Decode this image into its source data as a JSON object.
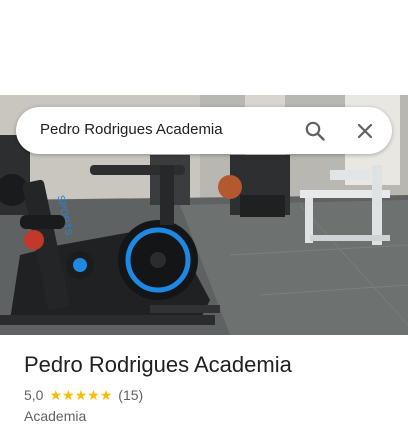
{
  "search": {
    "query": "Pedro Rodrigues Academia"
  },
  "place": {
    "title": "Pedro Rodrigues Academia",
    "rating": "5,0",
    "rating_stars": 5,
    "reviews": "(15)",
    "category": "Academia"
  },
  "hero": {
    "bike_brand_text": "SPORTS"
  },
  "icons": {
    "search": "search-icon",
    "close": "close-icon",
    "star": "star-icon"
  },
  "colors": {
    "star": "#fbbc04",
    "accent_blue": "#1e88e5",
    "text_primary": "#202124",
    "text_secondary": "#5f6368"
  }
}
